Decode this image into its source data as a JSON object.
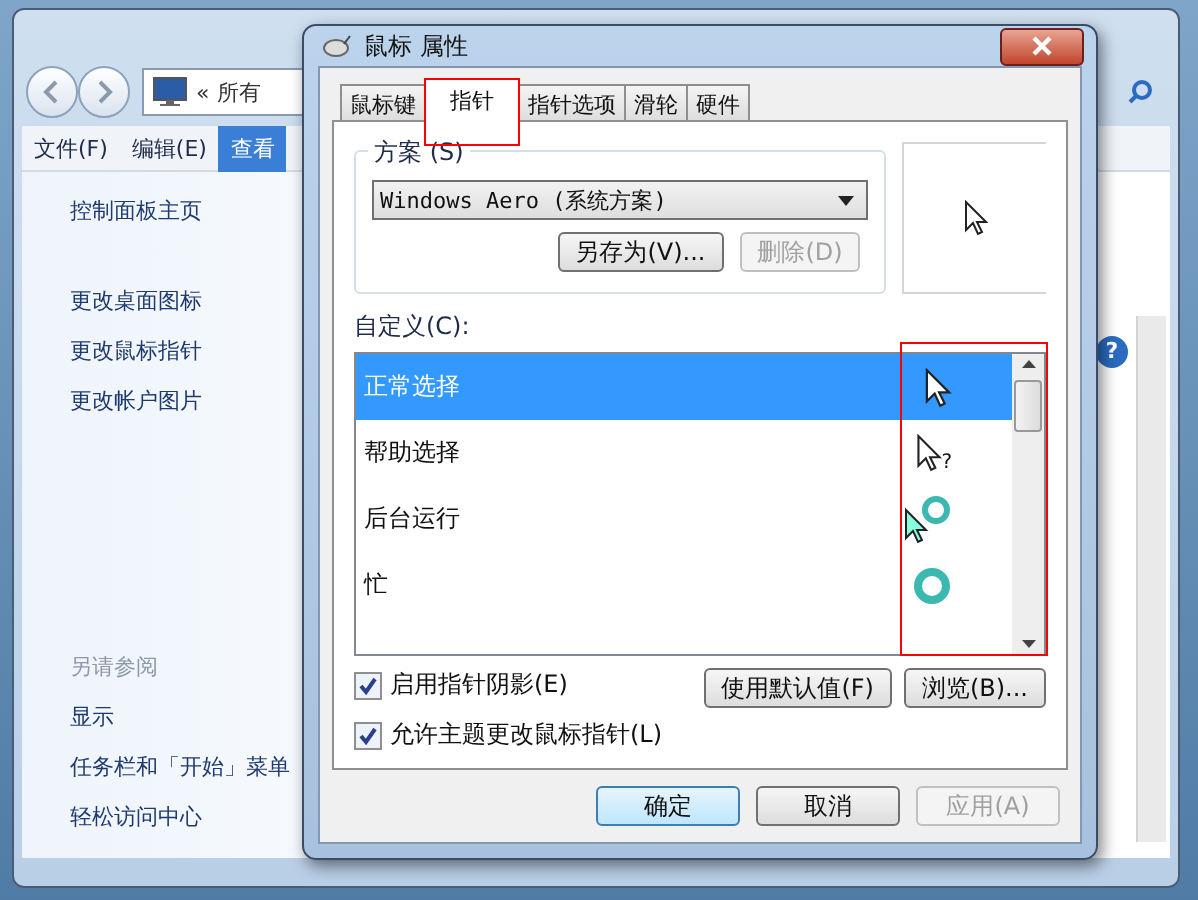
{
  "background_window": {
    "address_chevron": "«",
    "address": "所有",
    "help_glyph": "?",
    "menu": [
      {
        "label": "文件(F)",
        "selected": false
      },
      {
        "label": "编辑(E)",
        "selected": false
      },
      {
        "label": "查看",
        "selected": true
      }
    ],
    "sidebar": {
      "home": "控制面板主页",
      "links": [
        "更改桌面图标",
        "更改鼠标指针",
        "更改帐户图片"
      ],
      "see_also_title": "另请参阅",
      "see_also": [
        "显示",
        "任务栏和「开始」菜单",
        "轻松访问中心"
      ]
    }
  },
  "dialog": {
    "title": "鼠标 属性",
    "tabs": [
      {
        "label": "鼠标键",
        "selected": false
      },
      {
        "label": "指针",
        "selected": true
      },
      {
        "label": "指针选项",
        "selected": false
      },
      {
        "label": "滑轮",
        "selected": false
      },
      {
        "label": "硬件",
        "selected": false
      }
    ],
    "scheme": {
      "label": "方案 (S)",
      "value": "Windows Aero (系统方案)",
      "buttons": [
        {
          "label": "另存为(V)...",
          "disabled": false
        },
        {
          "label": "删除(D)",
          "disabled": true
        }
      ]
    },
    "customize_label": "自定义(C):",
    "cursors": [
      {
        "name": "正常选择",
        "kind": "arrow",
        "selected": true
      },
      {
        "name": "帮助选择",
        "kind": "help",
        "glyph": "?",
        "selected": false
      },
      {
        "name": "后台运行",
        "kind": "working",
        "selected": false
      },
      {
        "name": "忙",
        "kind": "busy",
        "selected": false
      }
    ],
    "checkboxes": [
      {
        "label": "启用指针阴影(E)",
        "checked": true
      },
      {
        "label": "允许主题更改鼠标指针(L)",
        "checked": true
      }
    ],
    "list_buttons": [
      {
        "label": "使用默认值(F)",
        "disabled": false
      },
      {
        "label": "浏览(B)...",
        "disabled": false
      }
    ],
    "footer_buttons": [
      {
        "label": "确定",
        "disabled": false,
        "default": true
      },
      {
        "label": "取消",
        "disabled": false,
        "default": false
      },
      {
        "label": "应用(A)",
        "disabled": true,
        "default": false
      }
    ]
  }
}
